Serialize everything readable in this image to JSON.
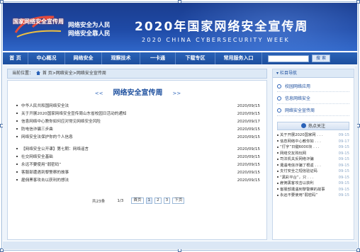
{
  "banner": {
    "logo_text": "国家网络安全宣传周",
    "slogan_line1": "网络安全为人民",
    "slogan_line2": "网络安全靠人民",
    "title": "2020年国家网络安全宣传周",
    "subtitle": "2020 CHINA CYBERSECURITY WEEK"
  },
  "nav": {
    "items": [
      "首 页",
      "中心概况",
      "网络安全",
      "观察技术",
      "一卡通",
      "下载专区",
      "常用服务入口"
    ],
    "search_placeholder": "",
    "search_button": "搜 索"
  },
  "breadcrumb": {
    "prefix": "当前位置：",
    "home": "首 页",
    "path": ">网络安全>网络安全宣传周"
  },
  "main": {
    "title": "网络安全宣传周",
    "arrow_left": "<<",
    "arrow_right": ">>",
    "group1": [
      {
        "title": "中华人民共和国网络安全法",
        "date": "2020/09/15"
      },
      {
        "title": "关于开展2020国家网络安全宣传周山东省校园日活动的通知",
        "date": "2020/09/15"
      },
      {
        "title": "信息网络中心教你如何应对常见网络安全风险",
        "date": "2020/09/17"
      },
      {
        "title": "防电信诈骗三步曲",
        "date": "2020/09/15"
      },
      {
        "title": "网络安全法保护你的个人信息",
        "date": "2020/09/15"
      }
    ],
    "group2": [
      {
        "title": "【网络安全公开课】第七期：网络谣言",
        "date": "2020/09/15"
      },
      {
        "title": "社交网络安全基础",
        "date": "2020/09/15"
      },
      {
        "title": "永远不要使用“弱密码”",
        "date": "2020/09/15"
      },
      {
        "title": "客服部遭遇到黎警察的故事",
        "date": "2020/09/15"
      },
      {
        "title": "雇佣黑客攻击以获利的想法",
        "date": "2020/09/15"
      }
    ],
    "pager": {
      "total": "共23条",
      "page": "1/3",
      "first": "首页",
      "pages": [
        "1",
        "2",
        "3"
      ],
      "next": "下页"
    }
  },
  "sidebar": {
    "head": "栏目导航",
    "nav": [
      "校园网络应用",
      "信息网络安全",
      "网络安全宣传周"
    ],
    "hot_head": "热点关注",
    "hot": [
      {
        "title": "关于开展2020国家网 . . .",
        "date": "09-15"
      },
      {
        "title": "信息网络中心教你如 . . .",
        "date": "09-17"
      },
      {
        "title": "“打字”日键6000块 . . .",
        "date": "09-15"
      },
      {
        "title": "网络交友购玩网",
        "date": "09-15"
      },
      {
        "title": "司法机关反网络诈骗",
        "date": "09-15"
      },
      {
        "title": "遭遇电信诈骗了根返 . . .",
        "date": "09-15"
      },
      {
        "title": "支付安全之短信验证码",
        "date": "09-15"
      },
      {
        "title": "“黑彩平台”，只 . . .",
        "date": "09-15"
      },
      {
        "title": "雇佣黑客攻击以获利",
        "date": "09-15"
      },
      {
        "title": "客服部遭遇到黎警察的故事",
        "date": "09-15"
      },
      {
        "title": "永远不要使用“弱密码”",
        "date": "09-15"
      }
    ]
  },
  "colors": {
    "brand_blue": "#1d4f9e",
    "banner_dark": "#1a3d8f",
    "panel_bg": "#eef4fb"
  }
}
